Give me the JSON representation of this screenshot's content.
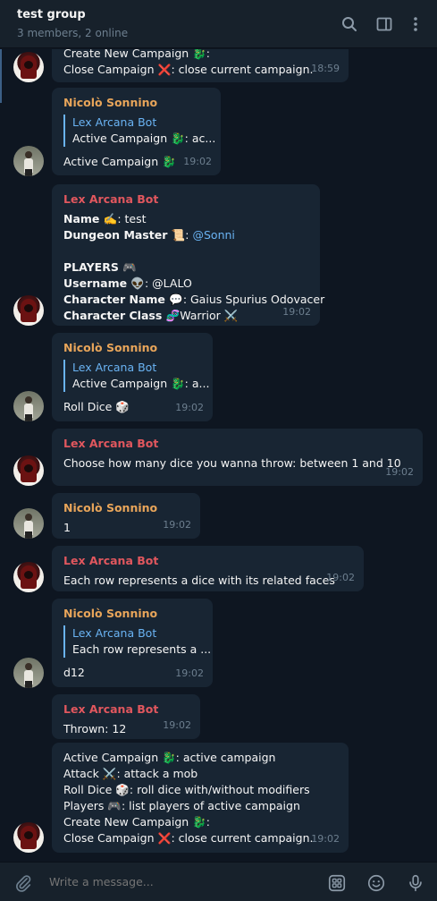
{
  "header": {
    "title": "test group",
    "subtitle": "3 members, 2 online"
  },
  "messages": {
    "m0": {
      "line1": "Create New Campaign 🐉:",
      "line2_pre": "Close Campaign ",
      "line2_emoji": "❌",
      "line2_post": ": close current campaign.",
      "time": "18:59"
    },
    "m1": {
      "sender": "Nicolò Sonnino",
      "reply_name": "Lex Arcana Bot",
      "reply_text": "Active Campaign 🐉: ac...",
      "text": "Active Campaign 🐉",
      "time": "19:02"
    },
    "m2": {
      "sender": "Lex Arcana Bot",
      "name_label": "Name ✍️",
      "name_value": ": test",
      "dm_label": "Dungeon Master 📜",
      "dm_sep": ": ",
      "dm_value": "@Sonni",
      "players_label": "PLAYERS 🎮",
      "username_label": "Username 👽",
      "username_value": ": @LALO",
      "charname_label": "Character Name 💬",
      "charname_value": ": Gaius Spurius Odovacer",
      "charclass_label": "Character Class 🧬",
      "charclass_value": "Warrior ⚔️",
      "time": "19:02"
    },
    "m3": {
      "sender": "Nicolò Sonnino",
      "reply_name": "Lex Arcana Bot",
      "reply_text": "Active Campaign 🐉: a...",
      "text": "Roll Dice 🎲",
      "time": "19:02"
    },
    "m4": {
      "sender": "Lex Arcana Bot",
      "text": "Choose how many dice you wanna throw: between 1 and 10",
      "time": "19:02"
    },
    "m5": {
      "sender": "Nicolò Sonnino",
      "text": "1",
      "time": "19:02"
    },
    "m6": {
      "sender": "Lex Arcana Bot",
      "text": "Each row represents a dice with its related faces",
      "time": "19:02"
    },
    "m7": {
      "sender": "Nicolò Sonnino",
      "reply_name": "Lex Arcana Bot",
      "reply_text": "Each row represents a ...",
      "text": "d12",
      "time": "19:02"
    },
    "m8": {
      "sender": "Lex Arcana Bot",
      "text": "Thrown: 12",
      "time": "19:02"
    },
    "m9": {
      "line1": "Active Campaign 🐉: active campaign",
      "line2": "Attack ⚔️: attack a mob",
      "line3": "Roll Dice 🎲: roll dice with/without modifiers",
      "line4": "Players 🎮: list players of active campaign",
      "line5": "Create New Campaign 🐉:",
      "line6_pre": "Close Campaign ",
      "line6_emoji": "❌",
      "line6_post": ": close current campaign.",
      "time": "19:02"
    }
  },
  "composer": {
    "placeholder": "Write a message..."
  },
  "icons": {
    "search": "search-icon",
    "sidebar": "sidebar-toggle-icon",
    "more": "more-vertical-icon",
    "attach": "paperclip-icon",
    "bot_commands": "bot-commands-icon",
    "emoji": "emoji-icon",
    "mic": "microphone-icon"
  },
  "colors": {
    "background": "#0e1621",
    "header": "#17212b",
    "bubble": "#182533",
    "bot_name": "#e1575e",
    "user_name": "#e8a55a",
    "link": "#6ab3f3",
    "muted": "#6d7f8f"
  }
}
